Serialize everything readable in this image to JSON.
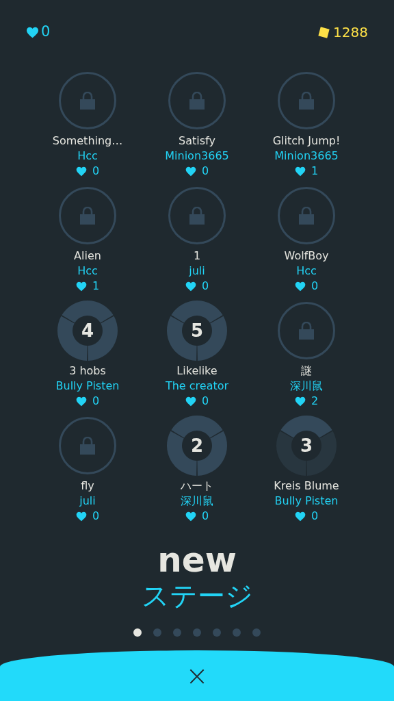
{
  "header": {
    "likes": "0",
    "coins": "1288"
  },
  "stages": [
    {
      "kind": "locked",
      "name": "Something…",
      "author": "Hcc",
      "likes": "0"
    },
    {
      "kind": "locked",
      "name": "Satisfy",
      "author": "Minion3665",
      "likes": "0"
    },
    {
      "kind": "locked",
      "name": "Glitch Jump!",
      "author": "Minion3665",
      "likes": "1"
    },
    {
      "kind": "locked",
      "name": "Alien",
      "author": "Hcc",
      "likes": "1"
    },
    {
      "kind": "locked",
      "name": "1",
      "author": "juli",
      "likes": "0"
    },
    {
      "kind": "locked",
      "name": "WolfBoy",
      "author": "Hcc",
      "likes": "0"
    },
    {
      "kind": "progress",
      "badge": "4",
      "level": 1,
      "name": "3 hobs",
      "author": "Bully Pisten",
      "likes": "0"
    },
    {
      "kind": "progress",
      "badge": "5",
      "level": 1,
      "name": "Likelike",
      "author": "The creator",
      "likes": "0"
    },
    {
      "kind": "locked",
      "name": "謎",
      "author": "深川鼠",
      "likes": "2"
    },
    {
      "kind": "locked",
      "name": "fly",
      "author": "juli",
      "likes": "0"
    },
    {
      "kind": "progress",
      "badge": "2",
      "level": 1,
      "name": "ハート",
      "author": "深川鼠",
      "likes": "0"
    },
    {
      "kind": "progress",
      "badge": "3",
      "level": 0.33,
      "name": "Kreis Blume",
      "author": "Bully Pisten",
      "likes": "0"
    }
  ],
  "title": {
    "line_1": "new",
    "line_2": "ステージ"
  },
  "pages": [
    {
      "selected": true
    },
    {
      "selected": false
    },
    {
      "selected": false
    },
    {
      "selected": false
    },
    {
      "selected": false
    },
    {
      "selected": false
    },
    {
      "selected": false
    }
  ],
  "close_label": "×"
}
